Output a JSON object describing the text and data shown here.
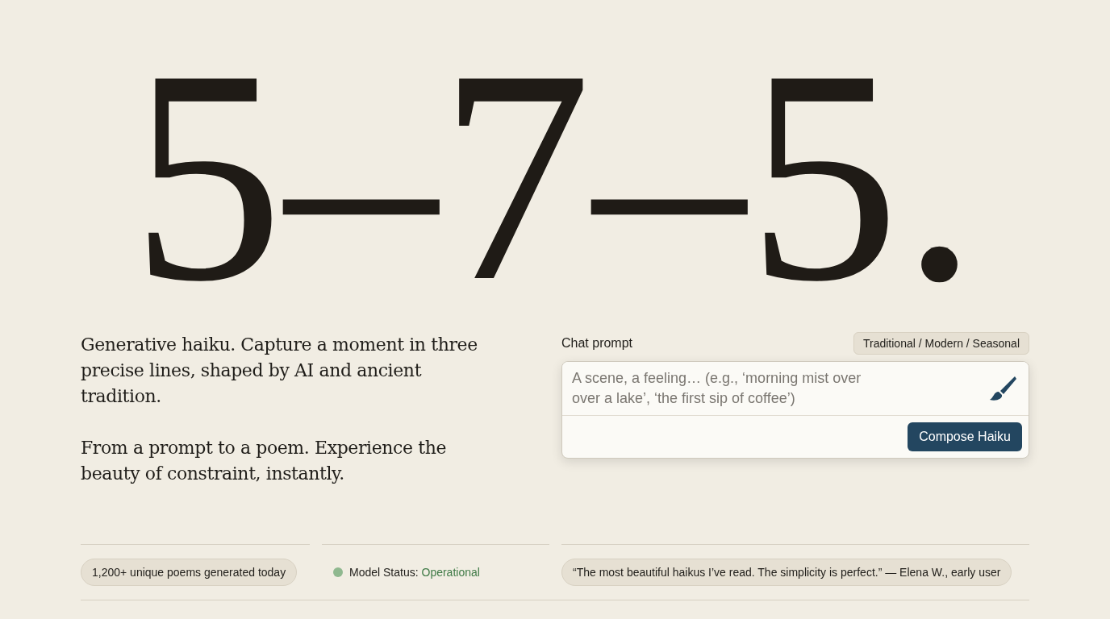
{
  "hero": {
    "title": "5–7–5."
  },
  "intro": {
    "paragraphs": [
      "Generative haiku. Capture a moment in three precise lines, shaped by AI and ancient tradition.",
      "From a prompt to a poem. Experience the beauty of constraint, instantly."
    ]
  },
  "prompt": {
    "label": "Chat prompt",
    "styles": "Traditional / Modern / Seasonal",
    "placeholder": "A scene, a feeling… (e.g., ‘morning mist over over a lake’, ‘the first sip of coffee’)",
    "button": "Compose Haiku"
  },
  "stats": {
    "count": "1,200+ unique poems generated today",
    "status": {
      "label": "Model Status:",
      "value": "Operational",
      "color": "#8fb88f"
    },
    "quote": "“The most beautiful haikus I’ve read. The simplicity is perfect.” — Elena W., early user"
  }
}
